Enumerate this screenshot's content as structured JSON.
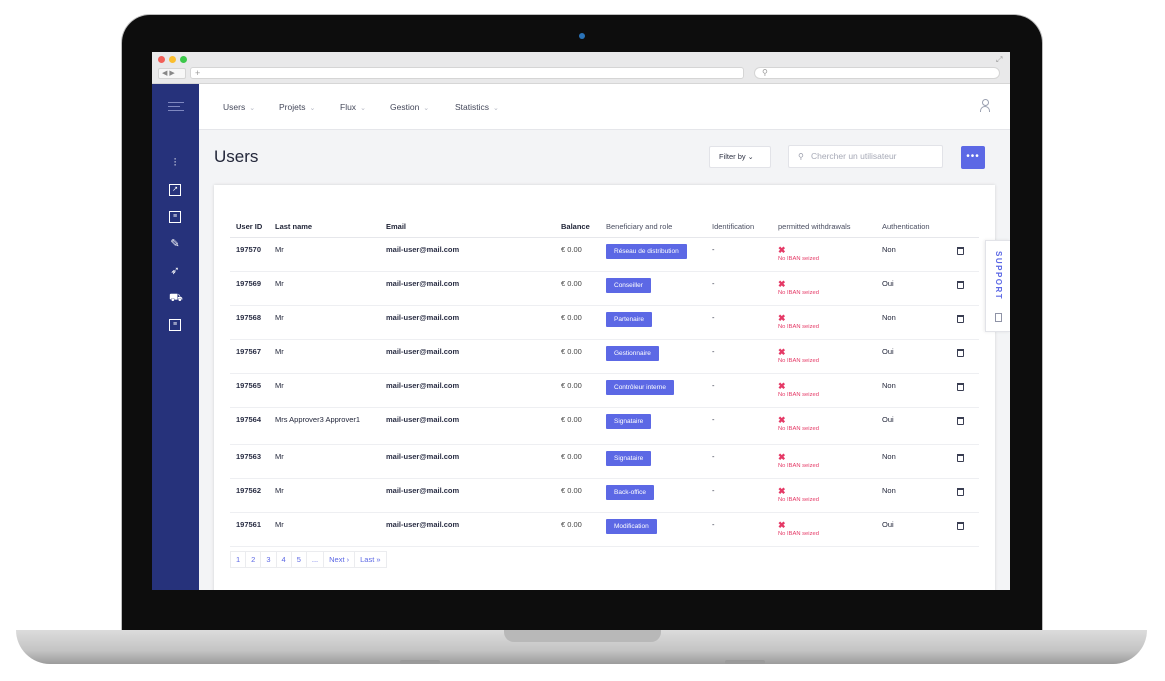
{
  "app": {
    "nav": [
      "Users",
      "Projets",
      "Flux",
      "Gestion",
      "Statistics"
    ],
    "page_title": "Users",
    "filter_label": "Filter by",
    "search_placeholder": "Chercher un utilisateur",
    "more_label": "•••",
    "support_label": "SUPPORT"
  },
  "sidebar_icons": [
    "sliders-icon",
    "chart-icon",
    "clipboard-icon",
    "edit-icon",
    "cursor-icon",
    "cart-icon",
    "document-icon"
  ],
  "table": {
    "headers": [
      "User ID",
      "Last name",
      "Email",
      "Balance",
      "Beneficiary and role",
      "Identification",
      "permitted withdrawals",
      "Authentication"
    ],
    "rows": [
      {
        "id": "197570",
        "name": "Mr",
        "email": "mail-user@mail.com",
        "balance": "€ 0.00",
        "role": "Réseau de distribution",
        "ident": "-",
        "withdraw": "No IBAN seized",
        "auth": "Non"
      },
      {
        "id": "197569",
        "name": "Mr",
        "email": "mail-user@mail.com",
        "balance": "€ 0.00",
        "role": "Conseiller",
        "ident": "-",
        "withdraw": "No IBAN seized",
        "auth": "Oui"
      },
      {
        "id": "197568",
        "name": "Mr",
        "email": "mail-user@mail.com",
        "balance": "€ 0.00",
        "role": "Partenaire",
        "ident": "-",
        "withdraw": "No IBAN seized",
        "auth": "Non"
      },
      {
        "id": "197567",
        "name": "Mr",
        "email": "mail-user@mail.com",
        "balance": "€ 0.00",
        "role": "Gestionnaire",
        "ident": "-",
        "withdraw": "No IBAN seized",
        "auth": "Oui"
      },
      {
        "id": "197565",
        "name": "Mr",
        "email": "mail-user@mail.com",
        "balance": "€ 0.00",
        "role": "Contrôleur interne",
        "ident": "-",
        "withdraw": "No IBAN seized",
        "auth": "Non"
      },
      {
        "id": "197564",
        "name": "Mrs Approver3 Approver1",
        "email": "mail-user@mail.com",
        "balance": "€ 0.00",
        "role": "Signataire",
        "ident": "-",
        "withdraw": "No IBAN seized",
        "auth": "Oui"
      },
      {
        "id": "197563",
        "name": "Mr",
        "email": "mail-user@mail.com",
        "balance": "€ 0.00",
        "role": "Signataire",
        "ident": "-",
        "withdraw": "No IBAN seized",
        "auth": "Non"
      },
      {
        "id": "197562",
        "name": "Mr",
        "email": "mail-user@mail.com",
        "balance": "€ 0.00",
        "role": "Back-office",
        "ident": "-",
        "withdraw": "No IBAN seized",
        "auth": "Non"
      },
      {
        "id": "197561",
        "name": "Mr",
        "email": "mail-user@mail.com",
        "balance": "€ 0.00",
        "role": "Modification",
        "ident": "-",
        "withdraw": "No IBAN seized",
        "auth": "Oui"
      }
    ]
  },
  "pagination": [
    "1",
    "2",
    "3",
    "4",
    "5",
    "...",
    "Next ›",
    "Last »"
  ],
  "colors": {
    "sidebar": "#26327b",
    "accent": "#5c68e5",
    "error": "#e53966"
  }
}
